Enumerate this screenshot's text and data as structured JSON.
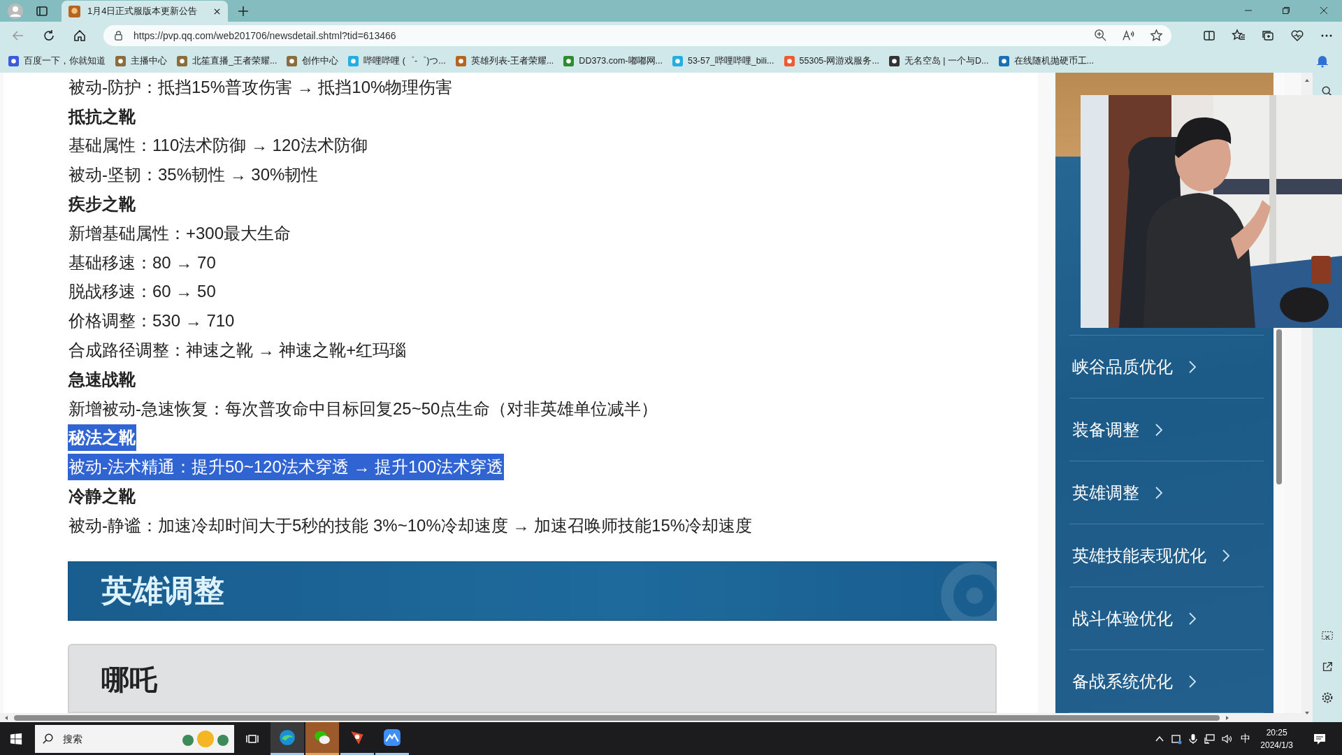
{
  "browser": {
    "tabs": [
      {
        "title": "1月4日正式服版本更新公告",
        "selected": true
      }
    ],
    "address": "https://pvp.qq.com/web201706/newsdetail.shtml?tid=613466",
    "bookmarks": [
      {
        "label": "百度一下，你就知道"
      },
      {
        "label": "主播中心"
      },
      {
        "label": "北笙直播_王者荣耀..."
      },
      {
        "label": "创作中心"
      },
      {
        "label": "哔哩哔哩 (゜-゜)つ..."
      },
      {
        "label": "英雄列表-王者荣耀..."
      },
      {
        "label": "DD373.com-嘟嘟网..."
      },
      {
        "label": "53-57_哔哩哔哩_bili..."
      },
      {
        "label": "55305-网游戏服务..."
      },
      {
        "label": "无名空岛 | 一个与D..."
      },
      {
        "label": "在线随机抛硬币工..."
      }
    ]
  },
  "article": {
    "lines": [
      {
        "kind": "text",
        "text": "被动-防护：抵挡15%普攻伤害 → 抵挡10%物理伤害",
        "selected": false
      },
      {
        "kind": "heading",
        "text": "抵抗之靴",
        "selected": false
      },
      {
        "kind": "text",
        "text": "基础属性：110法术防御 → 120法术防御",
        "selected": false
      },
      {
        "kind": "text",
        "text": "被动-坚韧：35%韧性 → 30%韧性",
        "selected": false
      },
      {
        "kind": "heading",
        "text": "疾步之靴",
        "selected": false
      },
      {
        "kind": "text",
        "text": "新增基础属性：+300最大生命",
        "selected": false
      },
      {
        "kind": "text",
        "text": "基础移速：80 → 70",
        "selected": false
      },
      {
        "kind": "text",
        "text": "脱战移速：60 → 50",
        "selected": false
      },
      {
        "kind": "text",
        "text": "价格调整：530 → 710",
        "selected": false
      },
      {
        "kind": "text",
        "text": "合成路径调整：神速之靴 → 神速之靴+红玛瑙",
        "selected": false
      },
      {
        "kind": "heading",
        "text": "急速战靴",
        "selected": false
      },
      {
        "kind": "text",
        "text": "新增被动-急速恢复：每次普攻命中目标回复25~50点生命（对非英雄单位减半）",
        "selected": false
      },
      {
        "kind": "heading",
        "text": "秘法之靴",
        "selected": true
      },
      {
        "kind": "text",
        "text": "被动-法术精通：提升50~120法术穿透 → 提升100法术穿透",
        "selected": true
      },
      {
        "kind": "heading",
        "text": "冷静之靴",
        "selected": false
      },
      {
        "kind": "text",
        "text": "被动-静谧：加速冷却时间大于5秒的技能 3%~10%冷却速度 → 加速召唤师技能15%冷却速度",
        "selected": false
      }
    ],
    "section_banner": "英雄调整",
    "hero_card": "哪吒"
  },
  "sidebar": {
    "items": [
      {
        "label": "峡谷品质优化"
      },
      {
        "label": "装备调整"
      },
      {
        "label": "英雄调整"
      },
      {
        "label": "英雄技能表现优化"
      },
      {
        "label": "战斗体验优化"
      },
      {
        "label": "备战系统优化"
      }
    ]
  },
  "taskbar": {
    "search_placeholder": "搜索",
    "ime": "中",
    "time": "20:25",
    "date": "2024/1/3"
  }
}
